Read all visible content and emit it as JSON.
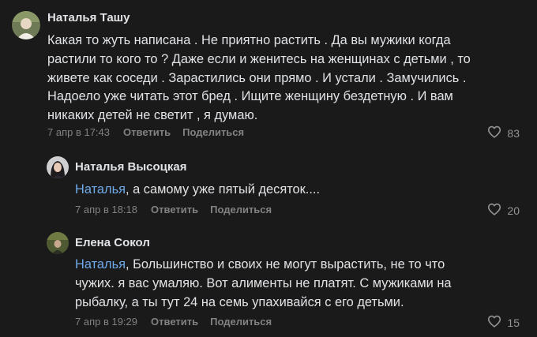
{
  "comments": [
    {
      "author": "Наталья Ташу",
      "mention": "",
      "lines": [
        "Какая то жуть написана . Не приятно растить . Да вы мужики когда",
        "растили то кого то ? Даже если и женитесь на женщинах с детьми , то",
        "живете как соседи . Зарастились они прямо . И устали . Замучились .",
        "Надоело уже читать этот бред . Ищите женщину бездетную . И вам",
        "никаких детей не светит , я думаю."
      ],
      "date": "7 апр в 17:43",
      "reply_label": "Ответить",
      "share_label": "Поделиться",
      "likes": "83",
      "like_icon": "heart-icon"
    },
    {
      "author": "Наталья Высоцкая",
      "mention": "Наталья",
      "lines": [
        ", а самому уже пятый десяток...."
      ],
      "date": "7 апр в 18:18",
      "reply_label": "Ответить",
      "share_label": "Поделиться",
      "likes": "20",
      "like_icon": "heart-icon"
    },
    {
      "author": "Елена Сокол",
      "mention": "Наталья",
      "lines": [
        ", Большинство и своих не могут вырастить, не то что",
        "чужих. я вас умаляю. Вот алименты не платят. С мужиками на",
        "рыбалку, а ты тут 24 на семь упахивайся с его детьми."
      ],
      "date": "7 апр в 19:29",
      "reply_label": "Ответить",
      "share_label": "Поделиться",
      "likes": "15",
      "like_icon": "heart-icon"
    }
  ]
}
